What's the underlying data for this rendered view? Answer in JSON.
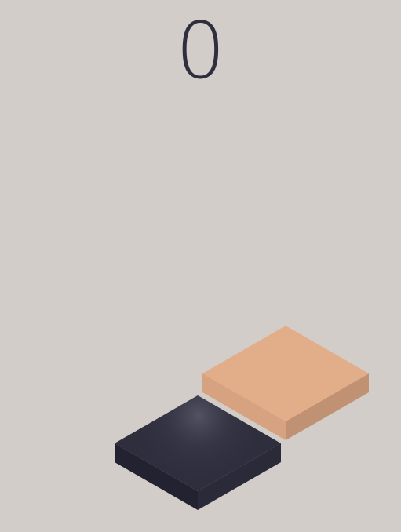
{
  "score": "0",
  "colors": {
    "background": "#d3cdca",
    "score_text": "#2f2e3f",
    "next_block_top": "#e2ae8a",
    "next_block_left_side": "#d6a27f",
    "next_block_right_side": "#c19173",
    "player_block_top": "#2f2e3d",
    "player_block_left_side": "#232231",
    "player_block_right_side": "#2b2a39"
  }
}
